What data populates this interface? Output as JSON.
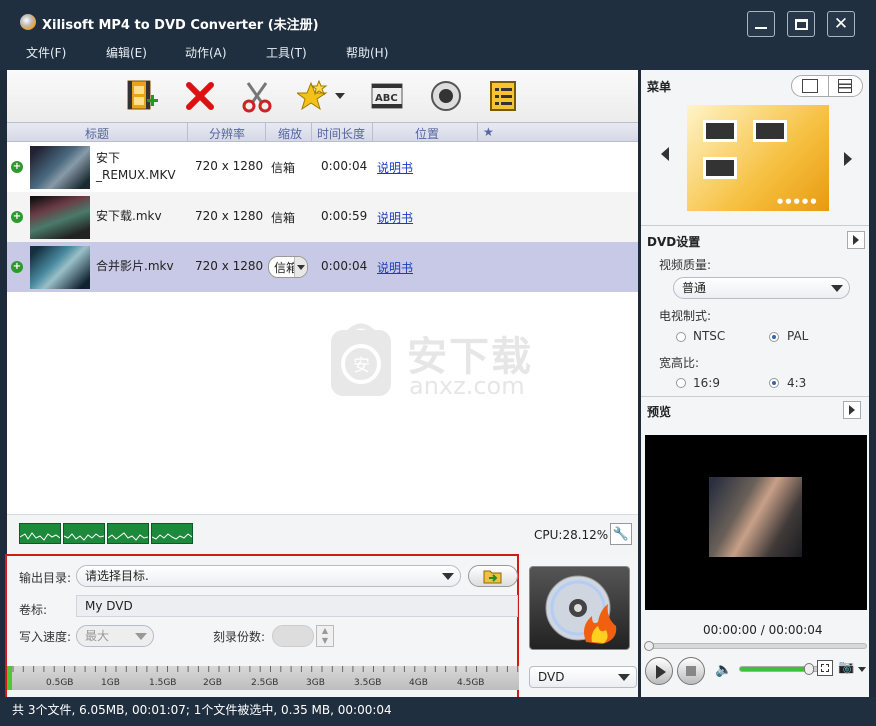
{
  "window": {
    "title": "Xilisoft MP4 to DVD Converter (未注册)"
  },
  "menu": [
    "文件(F)",
    "编辑(E)",
    "动作(A)",
    "工具(T)",
    "帮助(H)"
  ],
  "columns": {
    "title": "标题",
    "resolution": "分辨率",
    "zoom": "缩放",
    "duration": "时间长度",
    "position": "位置",
    "star": "★"
  },
  "files": [
    {
      "name": "安下_REMUX.MKV",
      "name_line1": "安下",
      "name_line2": "_REMUX.MKV",
      "resolution": "720 x 1280",
      "zoom": "信箱",
      "duration": "0:00:04",
      "position": "说明书"
    },
    {
      "name": "安下载.mkv",
      "resolution": "720 x 1280",
      "zoom": "信箱",
      "duration": "0:00:59",
      "position": "说明书"
    },
    {
      "name": "合并影片.mkv",
      "resolution": "720 x 1280",
      "zoom": "信箱",
      "duration": "0:00:04",
      "position": "说明书"
    }
  ],
  "watermark": {
    "text": "安下载",
    "sub": "anxz.com"
  },
  "cpu": "CPU:28.12%",
  "output": {
    "dir_label": "输出目录:",
    "dir_value": "请选择目标.",
    "volume_label": "卷标:",
    "volume_value": "My DVD",
    "speed_label": "写入速度:",
    "speed_value": "最大",
    "copies_label": "刻录份数:",
    "ruler": [
      "0.5GB",
      "1GB",
      "1.5GB",
      "2GB",
      "2.5GB",
      "3GB",
      "3.5GB",
      "4GB",
      "4.5GB"
    ],
    "disc_type": "DVD"
  },
  "right": {
    "menu_title": "菜单",
    "dvd_title": "DVD设置",
    "quality_label": "视频质量:",
    "quality_value": "普通",
    "tv_label": "电视制式:",
    "ntsc": "NTSC",
    "pal": "PAL",
    "aspect_label": "宽高比:",
    "a169": "16:9",
    "a43": "4:3",
    "preview_title": "预览",
    "time": "00:00:00 / 00:00:04",
    "volume_level": 0.82
  },
  "status": "共 3个文件, 6.05MB,  00:01:07; 1个文件被选中, 0.35 MB,  00:00:04"
}
